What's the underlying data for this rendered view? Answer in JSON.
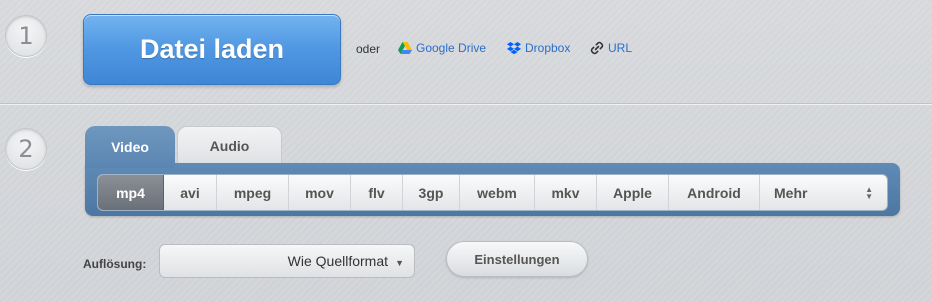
{
  "steps": {
    "step1": "1",
    "step2": "2"
  },
  "upload": {
    "button_label": "Datei laden",
    "or_label": "oder",
    "sources": [
      {
        "label": "Google Drive",
        "icon": "google-drive-icon"
      },
      {
        "label": "Dropbox",
        "icon": "dropbox-icon"
      },
      {
        "label": "URL",
        "icon": "link-icon"
      }
    ]
  },
  "tabs": [
    {
      "label": "Video",
      "active": true
    },
    {
      "label": "Audio",
      "active": false
    }
  ],
  "formats": [
    {
      "label": "mp4",
      "active": true
    },
    {
      "label": "avi"
    },
    {
      "label": "mpeg"
    },
    {
      "label": "mov"
    },
    {
      "label": "flv"
    },
    {
      "label": "3gp"
    },
    {
      "label": "webm"
    },
    {
      "label": "mkv"
    },
    {
      "label": "Apple"
    },
    {
      "label": "Android"
    },
    {
      "label": "Mehr"
    }
  ],
  "resolution": {
    "label": "Auflösung:",
    "selected": "Wie Quellformat"
  },
  "settings": {
    "label": "Einstellungen"
  },
  "colors": {
    "accent_blue": "#4f97e2",
    "panel_blue": "#5b86b2",
    "link_blue": "#2a6fc9"
  }
}
